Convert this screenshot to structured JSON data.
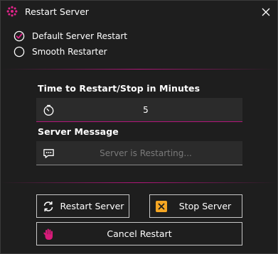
{
  "window": {
    "title": "Restart Server",
    "accent_color": "#b3167a"
  },
  "mode": {
    "selected": "default",
    "options": [
      {
        "id": "default",
        "label": "Default Server Restart",
        "checked": true
      },
      {
        "id": "smooth",
        "label": "Smooth Restarter",
        "checked": false
      }
    ]
  },
  "time": {
    "label": "Time to Restart/Stop in Minutes",
    "value": "5",
    "icon": "stopwatch-icon"
  },
  "message": {
    "label": "Server Message",
    "value": "",
    "placeholder": "Server is Restarting...",
    "icon": "chat-icon"
  },
  "actions": {
    "restart_label": "Restart Server",
    "stop_label": "Stop Server",
    "cancel_label": "Cancel Restart",
    "stop_icon_color": "#f5a623",
    "cancel_icon_color": "#d81b7a"
  }
}
